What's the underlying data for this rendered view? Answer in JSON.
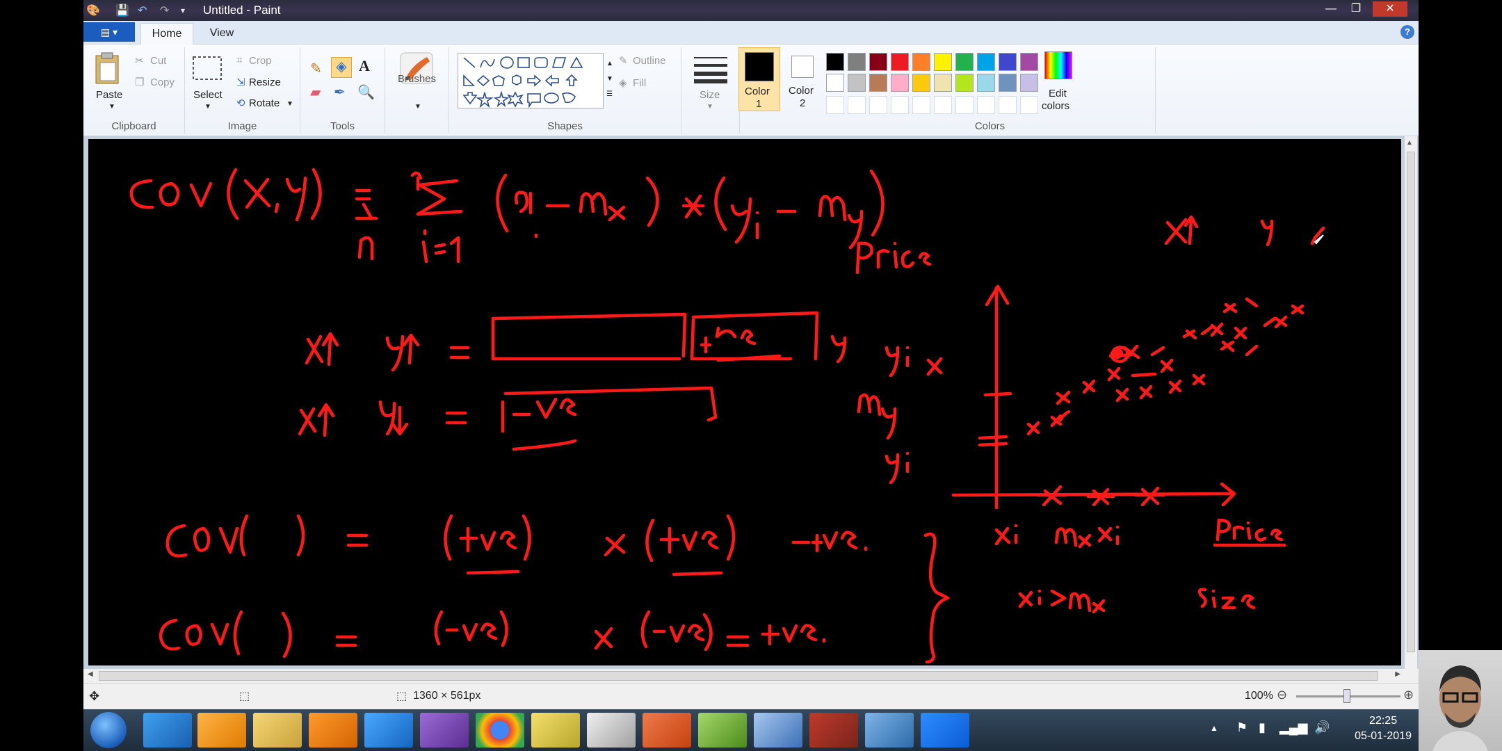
{
  "window": {
    "title": "Untitled - Paint",
    "controls": {
      "minimize": "—",
      "maximize": "❐",
      "close": "✕"
    }
  },
  "tabs": {
    "file": "▤ ▾",
    "home": "Home",
    "view": "View",
    "help": "?"
  },
  "ribbon": {
    "clipboard": {
      "paste": "Paste",
      "cut": "Cut",
      "copy": "Copy",
      "label": "Clipboard"
    },
    "image": {
      "select": "Select",
      "crop": "Crop",
      "resize": "Resize",
      "rotate": "Rotate",
      "label": "Image"
    },
    "tools": {
      "label": "Tools"
    },
    "brushes": {
      "label": "Brushes"
    },
    "shapes": {
      "outline": "Outline",
      "fill": "Fill",
      "label": "Shapes"
    },
    "size": {
      "label": "Size"
    },
    "color1": {
      "label": "Color",
      "num": "1"
    },
    "color2": {
      "label": "Color",
      "num": "2"
    },
    "colors": {
      "label": "Colors",
      "row1": [
        "#000000",
        "#7f7f7f",
        "#880015",
        "#ed1c24",
        "#ff7f27",
        "#fff200",
        "#22b14c",
        "#00a2e8",
        "#3f48cc",
        "#a349a4"
      ],
      "row2": [
        "#ffffff",
        "#c3c3c3",
        "#b97a57",
        "#ffaec9",
        "#ffc90e",
        "#efe4b0",
        "#b5e61d",
        "#99d9ea",
        "#7092be",
        "#c8bfe7"
      ]
    },
    "edit_colors": {
      "line1": "Edit",
      "line2": "colors"
    }
  },
  "ink_color": "#ff1a1a",
  "statusbar": {
    "canvas_size": "1360 × 561px",
    "zoom": "100%"
  },
  "taskbar": {
    "apps": [
      "start-orb",
      "internet-explorer",
      "media-player",
      "file-explorer",
      "vlc",
      "settings",
      "visual-studio",
      "chrome",
      "sticky-notes",
      "network-app",
      "powerpoint",
      "notepad-app",
      "paint",
      "winrar",
      "remote-desktop",
      "zoom"
    ],
    "time": "22:25",
    "date": "05-01-2019"
  }
}
